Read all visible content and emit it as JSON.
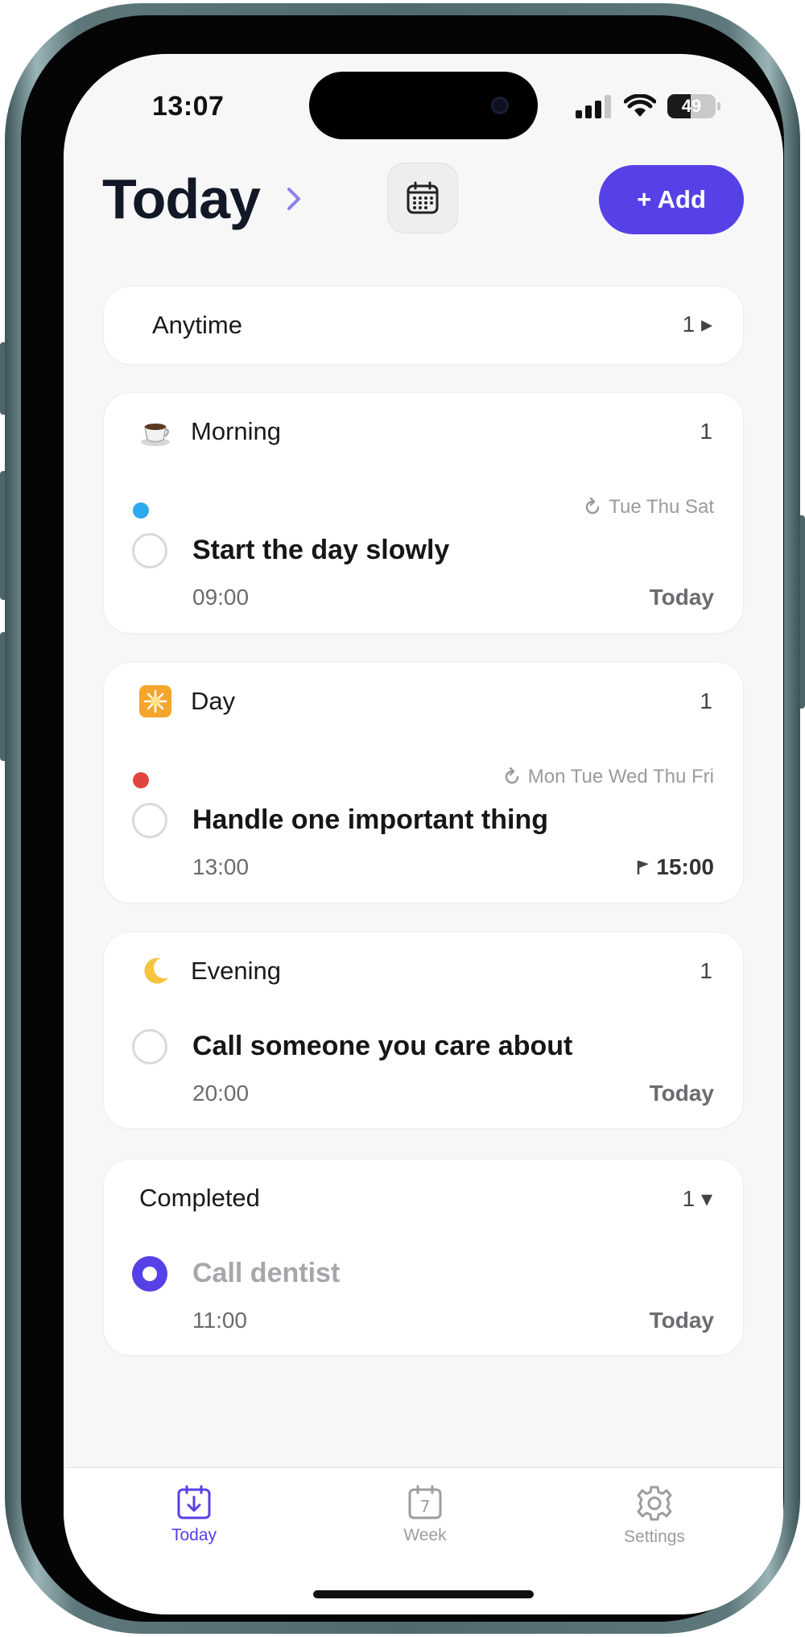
{
  "status_bar": {
    "time": "13:07",
    "battery": "49",
    "battery_level": 0.49
  },
  "header": {
    "title": "Today",
    "calendar_icon": "calendar-icon",
    "add_label": "+ Add"
  },
  "colors": {
    "accent": "#5641e6",
    "morning_dot": "#2ea8ef",
    "day_dot": "#e0463e"
  },
  "sections": {
    "anytime": {
      "title": "Anytime",
      "count": "1 ▸"
    },
    "morning": {
      "title": "Morning",
      "count": "1",
      "task": {
        "repeat": "Tue Thu Sat",
        "title": "Start the day slowly",
        "time": "09:00",
        "due": "Today"
      }
    },
    "day": {
      "title": "Day",
      "count": "1",
      "task": {
        "repeat": "Mon Tue Wed Thu Fri",
        "title": "Handle one important thing",
        "time": "13:00",
        "due": "15:00"
      }
    },
    "evening": {
      "title": "Evening",
      "count": "1",
      "task": {
        "title": "Call someone you care about",
        "time": "20:00",
        "due": "Today"
      }
    },
    "completed": {
      "title": "Completed",
      "count": "1 ▾",
      "task": {
        "title": "Call dentist",
        "time": "11:00",
        "due": "Today"
      }
    }
  },
  "tabbar": {
    "today": {
      "label": "Today"
    },
    "week": {
      "label": "Week",
      "icon_number": "7"
    },
    "settings": {
      "label": "Settings"
    }
  }
}
